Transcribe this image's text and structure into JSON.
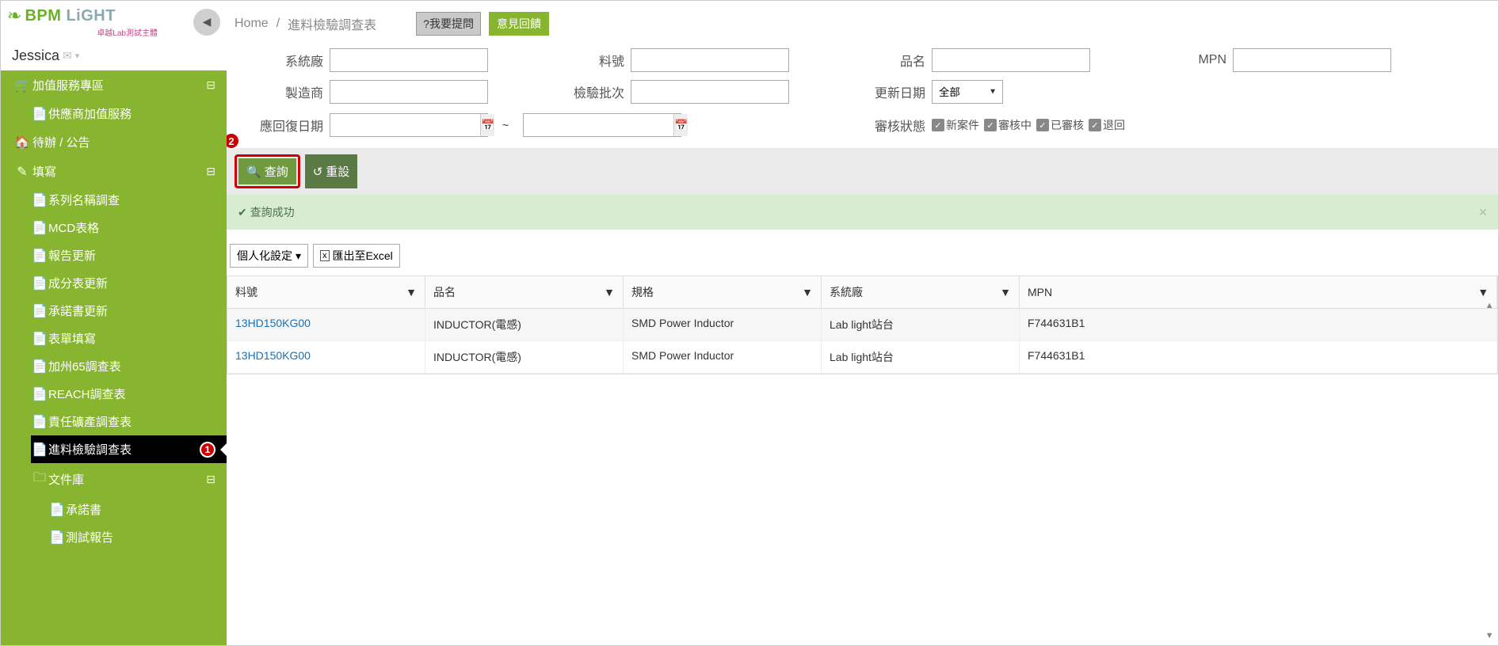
{
  "brand": {
    "name": "BPM LiGHT",
    "sub": "卓越Lab測試主體"
  },
  "user": {
    "name": "Jessica"
  },
  "sidebar": {
    "sections": [
      {
        "icon": "🛒",
        "label": "加值服務專區",
        "exp": "⊟",
        "items": [
          {
            "icon": "📄",
            "label": "供應商加值服務"
          }
        ]
      },
      {
        "icon": "🏠",
        "label": "待辦 / 公告"
      },
      {
        "icon": "✎",
        "label": "填寫",
        "exp": "⊟",
        "items": [
          {
            "icon": "📄",
            "label": "系列名稱調查"
          },
          {
            "icon": "📄",
            "label": "MCD表格"
          },
          {
            "icon": "📄",
            "label": "報告更新"
          },
          {
            "icon": "📄",
            "label": "成分表更新"
          },
          {
            "icon": "📄",
            "label": "承諾書更新"
          },
          {
            "icon": "📄",
            "label": "表單填寫"
          },
          {
            "icon": "📄",
            "label": "加州65調查表"
          },
          {
            "icon": "📄",
            "label": "REACH調查表"
          },
          {
            "icon": "📄",
            "label": "責任礦產調查表"
          },
          {
            "icon": "📄",
            "label": "進料檢驗調查表",
            "active": true,
            "badge": "1"
          },
          {
            "icon": "🗀",
            "label": "文件庫",
            "exp": "⊟",
            "items": [
              {
                "icon": "📄",
                "label": "承諾書"
              },
              {
                "icon": "📄",
                "label": "測試報告"
              }
            ]
          }
        ]
      }
    ]
  },
  "breadcrumb": {
    "home": "Home",
    "sep": "/",
    "title": "進料檢驗調查表"
  },
  "topButtons": {
    "ask": "?我要提問",
    "feedback": "意見回饋"
  },
  "form": {
    "labels": {
      "system": "系統廠",
      "partno": "料號",
      "prodname": "品名",
      "mpn": "MPN",
      "maker": "製造商",
      "batch": "檢驗批次",
      "updated": "更新日期",
      "reply": "應回復日期",
      "status": "審核狀態",
      "to": "~"
    },
    "updated_sel": "全部",
    "status_opts": [
      "新案件",
      "審核中",
      "已審核",
      "退回"
    ]
  },
  "annot2": "2",
  "actions": {
    "search": "查詢",
    "reset": "重設"
  },
  "alert": {
    "text": "查詢成功"
  },
  "tableTools": {
    "personalize": "個人化設定",
    "export": "匯出至Excel"
  },
  "grid": {
    "headers": [
      "料號",
      "品名",
      "規格",
      "系統廠",
      "MPN"
    ],
    "rows": [
      {
        "c1": "13HD150KG00",
        "c2": "INDUCTOR(電感)",
        "c3": "SMD Power Inductor",
        "c4": "Lab light站台",
        "c5": "F744631B1"
      },
      {
        "c1": "13HD150KG00",
        "c2": "INDUCTOR(電感)",
        "c3": "SMD Power Inductor",
        "c4": "Lab light站台",
        "c5": "F744631B1"
      }
    ]
  }
}
